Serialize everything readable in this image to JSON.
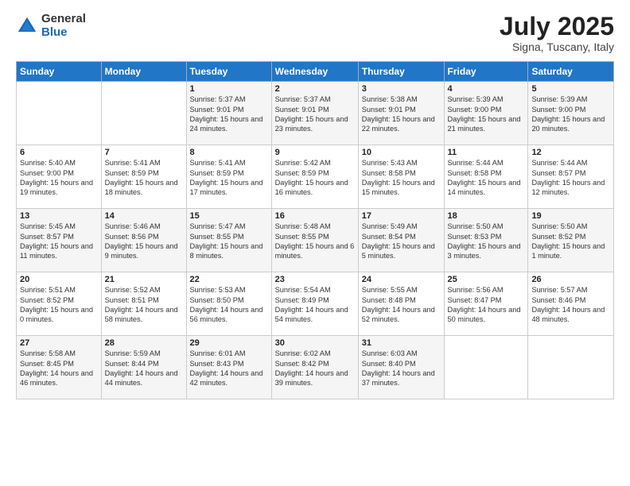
{
  "header": {
    "logo_general": "General",
    "logo_blue": "Blue",
    "month_year": "July 2025",
    "location": "Signa, Tuscany, Italy"
  },
  "weekdays": [
    "Sunday",
    "Monday",
    "Tuesday",
    "Wednesday",
    "Thursday",
    "Friday",
    "Saturday"
  ],
  "weeks": [
    [
      null,
      null,
      {
        "day": "1",
        "sunrise": "5:37 AM",
        "sunset": "9:01 PM",
        "daylight": "15 hours and 24 minutes."
      },
      {
        "day": "2",
        "sunrise": "5:37 AM",
        "sunset": "9:01 PM",
        "daylight": "15 hours and 23 minutes."
      },
      {
        "day": "3",
        "sunrise": "5:38 AM",
        "sunset": "9:01 PM",
        "daylight": "15 hours and 22 minutes."
      },
      {
        "day": "4",
        "sunrise": "5:39 AM",
        "sunset": "9:00 PM",
        "daylight": "15 hours and 21 minutes."
      },
      {
        "day": "5",
        "sunrise": "5:39 AM",
        "sunset": "9:00 PM",
        "daylight": "15 hours and 20 minutes."
      }
    ],
    [
      {
        "day": "6",
        "sunrise": "5:40 AM",
        "sunset": "9:00 PM",
        "daylight": "15 hours and 19 minutes."
      },
      {
        "day": "7",
        "sunrise": "5:41 AM",
        "sunset": "8:59 PM",
        "daylight": "15 hours and 18 minutes."
      },
      {
        "day": "8",
        "sunrise": "5:41 AM",
        "sunset": "8:59 PM",
        "daylight": "15 hours and 17 minutes."
      },
      {
        "day": "9",
        "sunrise": "5:42 AM",
        "sunset": "8:59 PM",
        "daylight": "15 hours and 16 minutes."
      },
      {
        "day": "10",
        "sunrise": "5:43 AM",
        "sunset": "8:58 PM",
        "daylight": "15 hours and 15 minutes."
      },
      {
        "day": "11",
        "sunrise": "5:44 AM",
        "sunset": "8:58 PM",
        "daylight": "15 hours and 14 minutes."
      },
      {
        "day": "12",
        "sunrise": "5:44 AM",
        "sunset": "8:57 PM",
        "daylight": "15 hours and 12 minutes."
      }
    ],
    [
      {
        "day": "13",
        "sunrise": "5:45 AM",
        "sunset": "8:57 PM",
        "daylight": "15 hours and 11 minutes."
      },
      {
        "day": "14",
        "sunrise": "5:46 AM",
        "sunset": "8:56 PM",
        "daylight": "15 hours and 9 minutes."
      },
      {
        "day": "15",
        "sunrise": "5:47 AM",
        "sunset": "8:55 PM",
        "daylight": "15 hours and 8 minutes."
      },
      {
        "day": "16",
        "sunrise": "5:48 AM",
        "sunset": "8:55 PM",
        "daylight": "15 hours and 6 minutes."
      },
      {
        "day": "17",
        "sunrise": "5:49 AM",
        "sunset": "8:54 PM",
        "daylight": "15 hours and 5 minutes."
      },
      {
        "day": "18",
        "sunrise": "5:50 AM",
        "sunset": "8:53 PM",
        "daylight": "15 hours and 3 minutes."
      },
      {
        "day": "19",
        "sunrise": "5:50 AM",
        "sunset": "8:52 PM",
        "daylight": "15 hours and 1 minute."
      }
    ],
    [
      {
        "day": "20",
        "sunrise": "5:51 AM",
        "sunset": "8:52 PM",
        "daylight": "15 hours and 0 minutes."
      },
      {
        "day": "21",
        "sunrise": "5:52 AM",
        "sunset": "8:51 PM",
        "daylight": "14 hours and 58 minutes."
      },
      {
        "day": "22",
        "sunrise": "5:53 AM",
        "sunset": "8:50 PM",
        "daylight": "14 hours and 56 minutes."
      },
      {
        "day": "23",
        "sunrise": "5:54 AM",
        "sunset": "8:49 PM",
        "daylight": "14 hours and 54 minutes."
      },
      {
        "day": "24",
        "sunrise": "5:55 AM",
        "sunset": "8:48 PM",
        "daylight": "14 hours and 52 minutes."
      },
      {
        "day": "25",
        "sunrise": "5:56 AM",
        "sunset": "8:47 PM",
        "daylight": "14 hours and 50 minutes."
      },
      {
        "day": "26",
        "sunrise": "5:57 AM",
        "sunset": "8:46 PM",
        "daylight": "14 hours and 48 minutes."
      }
    ],
    [
      {
        "day": "27",
        "sunrise": "5:58 AM",
        "sunset": "8:45 PM",
        "daylight": "14 hours and 46 minutes."
      },
      {
        "day": "28",
        "sunrise": "5:59 AM",
        "sunset": "8:44 PM",
        "daylight": "14 hours and 44 minutes."
      },
      {
        "day": "29",
        "sunrise": "6:01 AM",
        "sunset": "8:43 PM",
        "daylight": "14 hours and 42 minutes."
      },
      {
        "day": "30",
        "sunrise": "6:02 AM",
        "sunset": "8:42 PM",
        "daylight": "14 hours and 39 minutes."
      },
      {
        "day": "31",
        "sunrise": "6:03 AM",
        "sunset": "8:40 PM",
        "daylight": "14 hours and 37 minutes."
      },
      null,
      null
    ]
  ]
}
